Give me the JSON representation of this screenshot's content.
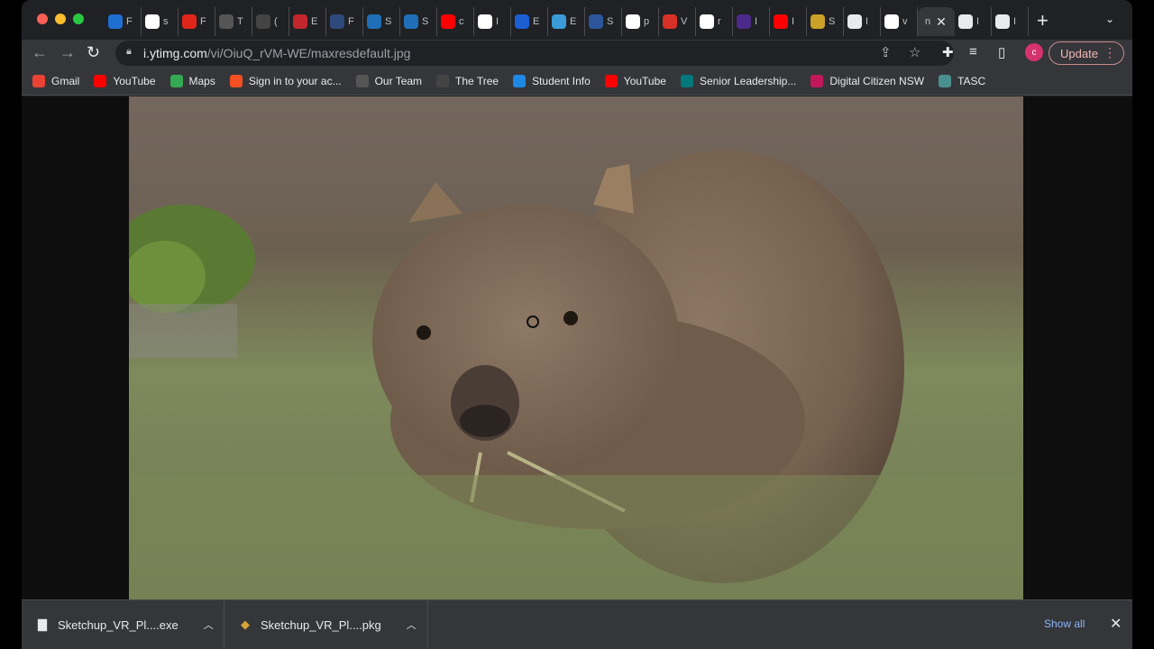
{
  "tabs": [
    {
      "letter": "F",
      "color": "#1f6fd1",
      "icon": "sketchup-icon"
    },
    {
      "letter": "s",
      "color": "#ffffff",
      "icon": "google-icon"
    },
    {
      "letter": "F",
      "color": "#e1251b",
      "icon": "adobe-icon"
    },
    {
      "letter": "T",
      "color": "#555",
      "icon": "tree-icon"
    },
    {
      "letter": "(",
      "color": "#444",
      "icon": "circle-logo-icon"
    },
    {
      "letter": "E",
      "color": "#c1272d",
      "icon": "red-logo-icon"
    },
    {
      "letter": "F",
      "color": "#2d4a7a",
      "icon": "shield-icon"
    },
    {
      "letter": "S",
      "color": "#1e6fb8",
      "icon": "fingerprint-icon"
    },
    {
      "letter": "S",
      "color": "#1e6fb8",
      "icon": "fingerprint-icon"
    },
    {
      "letter": "c",
      "color": "#ff0000",
      "icon": "youtube-icon"
    },
    {
      "letter": "I",
      "color": "#ffffff",
      "icon": "google-icon"
    },
    {
      "letter": "E",
      "color": "#1c5fd3",
      "icon": "lp-icon"
    },
    {
      "letter": "E",
      "color": "#3a9bd8",
      "icon": "app-icon"
    },
    {
      "letter": "S",
      "color": "#2b579a",
      "icon": "word-icon"
    },
    {
      "letter": "p",
      "color": "#ffffff",
      "icon": "google-icon"
    },
    {
      "letter": "V",
      "color": "#d93025",
      "icon": "store-icon"
    },
    {
      "letter": "r",
      "color": "#ffffff",
      "icon": "google-icon"
    },
    {
      "letter": "I",
      "color": "#4b2a8a",
      "icon": "bbc-icon"
    },
    {
      "letter": "I",
      "color": "#ff0000",
      "icon": "youtube-icon"
    },
    {
      "letter": "S",
      "color": "#c9a227",
      "icon": "gold-logo-icon"
    },
    {
      "letter": "I",
      "color": "#e8eaed",
      "icon": "chrome-icon"
    },
    {
      "letter": "v",
      "color": "#ffffff",
      "icon": "google-icon"
    },
    {
      "letter": "n",
      "color": "",
      "icon": "",
      "active": true
    },
    {
      "letter": "I",
      "color": "#e8eaed",
      "icon": "puzzle-icon"
    },
    {
      "letter": "I",
      "color": "#e8eaed",
      "icon": "chrome-icon"
    }
  ],
  "address": {
    "host": "i.ytimg.com",
    "path": "/vi/OiuQ_rVM-WE/maxresdefault.jpg"
  },
  "profile_initial": "c",
  "update_label": "Update",
  "bookmarks": [
    {
      "label": "Gmail",
      "color": "#ea4335",
      "glyph": "M"
    },
    {
      "label": "YouTube",
      "color": "#ff0000",
      "glyph": "▶"
    },
    {
      "label": "Maps",
      "color": "#34a853",
      "glyph": "◆"
    },
    {
      "label": "Sign in to your ac...",
      "color": "#f25022",
      "glyph": "■"
    },
    {
      "label": "Our Team",
      "color": "#555",
      "glyph": "✦"
    },
    {
      "label": "The Tree",
      "color": "#444",
      "glyph": "♣"
    },
    {
      "label": "Student Info",
      "color": "#1e88e5",
      "glyph": "☁"
    },
    {
      "label": "YouTube",
      "color": "#ff0000",
      "glyph": "▶"
    },
    {
      "label": "Senior Leadership...",
      "color": "#03787c",
      "glyph": "S"
    },
    {
      "label": "Digital Citizen NSW",
      "color": "#c2185b",
      "glyph": "✿"
    },
    {
      "label": "TASC",
      "color": "#4a8f8f",
      "glyph": "A"
    }
  ],
  "downloads": [
    {
      "name": "Sketchup_VR_Pl....exe",
      "icon": "file-icon"
    },
    {
      "name": "Sketchup_VR_Pl....pkg",
      "icon": "package-icon"
    }
  ],
  "show_all_label": "Show all"
}
